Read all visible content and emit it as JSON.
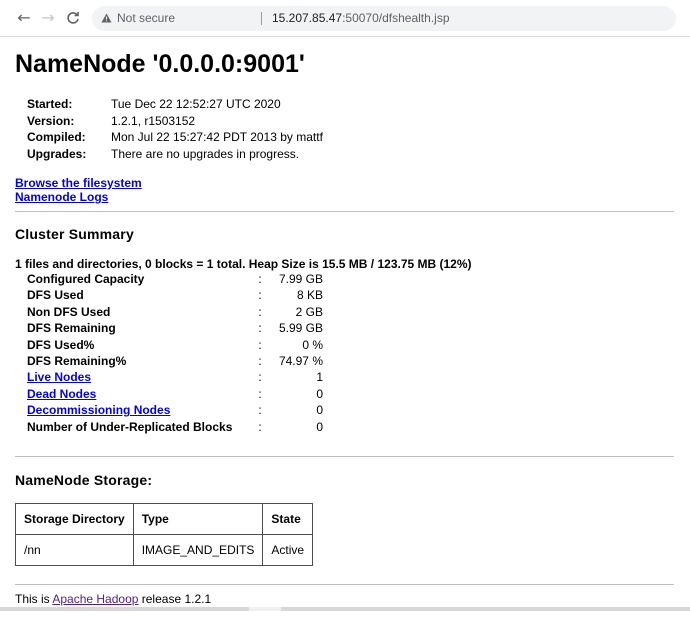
{
  "browser": {
    "back_icon": "←",
    "forward_icon": "→",
    "reload_icon": "C",
    "warning_icon": "▲",
    "security_label": "Not secure",
    "url_host": "15.207.85.47",
    "url_path": ":50070/dfshealth.jsp"
  },
  "page": {
    "title": "NameNode '0.0.0.0:9001'",
    "info": [
      {
        "key": "Started:",
        "value": "Tue Dec 22 12:52:27 UTC 2020"
      },
      {
        "key": "Version:",
        "value": "1.2.1, r1503152"
      },
      {
        "key": "Compiled:",
        "value": "Mon Jul 22 15:27:42 PDT 2013 by mattf"
      },
      {
        "key": "Upgrades:",
        "value": "There are no upgrades in progress."
      }
    ],
    "links": {
      "browse": "Browse the filesystem",
      "logs": "Namenode Logs"
    },
    "cluster_summary": {
      "heading": "Cluster Summary",
      "summary_line": "1 files and directories, 0 blocks = 1 total. Heap Size is 15.5 MB / 123.75 MB (12%)",
      "colon": ":",
      "rows": [
        {
          "name": "Configured Capacity",
          "value": "7.99 GB"
        },
        {
          "name": "DFS Used",
          "value": "8 KB"
        },
        {
          "name": "Non DFS Used",
          "value": "2 GB"
        },
        {
          "name": "DFS Remaining",
          "value": "5.99 GB"
        },
        {
          "name": "DFS Used%",
          "value": "0 %"
        },
        {
          "name": "DFS Remaining%",
          "value": "74.97 %"
        },
        {
          "name": "Live Nodes",
          "value": "1"
        },
        {
          "name": "Dead Nodes",
          "value": "0"
        },
        {
          "name": "Decommissioning Nodes",
          "value": "0"
        },
        {
          "name": "Number of Under-Replicated Blocks",
          "value": "0"
        }
      ]
    },
    "storage": {
      "heading": "NameNode Storage:",
      "headers": [
        "Storage Directory",
        "Type",
        "State"
      ],
      "rows": [
        [
          "/nn",
          "IMAGE_AND_EDITS",
          "Active"
        ]
      ]
    },
    "footer": {
      "prefix": "This is ",
      "link": "Apache Hadoop",
      "suffix": " release 1.2.1"
    }
  }
}
